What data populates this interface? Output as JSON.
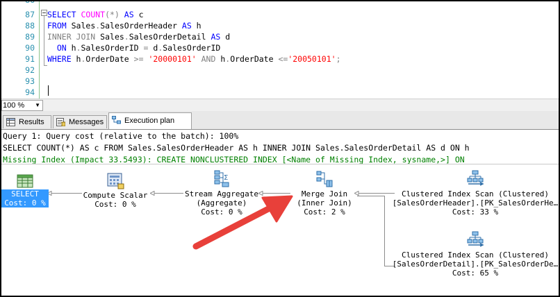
{
  "editor": {
    "lines": [
      {
        "num": "87",
        "tokens": [
          {
            "t": "SELECT ",
            "c": "kw"
          },
          {
            "t": "COUNT",
            "c": "fn"
          },
          {
            "t": "(*) ",
            "c": "op"
          },
          {
            "t": "AS ",
            "c": "kw"
          },
          {
            "t": "c",
            "c": ""
          }
        ]
      },
      {
        "num": "88",
        "tokens": [
          {
            "t": "FROM ",
            "c": "kw"
          },
          {
            "t": "Sales",
            "c": ""
          },
          {
            "t": ".",
            "c": "op"
          },
          {
            "t": "SalesOrderHeader ",
            "c": ""
          },
          {
            "t": "AS ",
            "c": "kw"
          },
          {
            "t": "h",
            "c": ""
          }
        ]
      },
      {
        "num": "89",
        "tokens": [
          {
            "t": "INNER JOIN ",
            "c": "op"
          },
          {
            "t": "Sales",
            "c": ""
          },
          {
            "t": ".",
            "c": "op"
          },
          {
            "t": "SalesOrderDetail ",
            "c": ""
          },
          {
            "t": "AS ",
            "c": "kw"
          },
          {
            "t": "d",
            "c": ""
          }
        ]
      },
      {
        "num": "90",
        "tokens": [
          {
            "t": "  ON ",
            "c": "kw"
          },
          {
            "t": "h",
            "c": ""
          },
          {
            "t": ".",
            "c": "op"
          },
          {
            "t": "SalesOrderID ",
            "c": ""
          },
          {
            "t": "= ",
            "c": "op"
          },
          {
            "t": "d",
            "c": ""
          },
          {
            "t": ".",
            "c": "op"
          },
          {
            "t": "SalesOrderID",
            "c": ""
          }
        ]
      },
      {
        "num": "91",
        "tokens": [
          {
            "t": "WHERE ",
            "c": "kw"
          },
          {
            "t": "h",
            "c": ""
          },
          {
            "t": ".",
            "c": "op"
          },
          {
            "t": "OrderDate ",
            "c": ""
          },
          {
            "t": ">= ",
            "c": "op"
          },
          {
            "t": "'20000101' ",
            "c": "str"
          },
          {
            "t": "AND ",
            "c": "op"
          },
          {
            "t": "h",
            "c": ""
          },
          {
            "t": ".",
            "c": "op"
          },
          {
            "t": "OrderDate ",
            "c": ""
          },
          {
            "t": "<=",
            "c": "op"
          },
          {
            "t": "'20050101'",
            "c": "str"
          },
          {
            "t": ";",
            "c": "op"
          }
        ]
      },
      {
        "num": "92",
        "tokens": []
      },
      {
        "num": "93",
        "tokens": []
      },
      {
        "num": "94",
        "tokens": []
      }
    ],
    "top_line_num": "86"
  },
  "zoom": {
    "value": "100 %"
  },
  "tabs": [
    {
      "label": "Results",
      "icon": "grid-icon"
    },
    {
      "label": "Messages",
      "icon": "messages-icon"
    },
    {
      "label": "Execution plan",
      "icon": "execution-plan-icon"
    }
  ],
  "messages": {
    "query_cost": "Query 1: Query cost (relative to the batch): 100%",
    "query_text": "SELECT COUNT(*) AS c FROM Sales.SalesOrderHeader AS h INNER JOIN Sales.SalesOrderDetail AS d ON h",
    "missing_index": "Missing Index (Impact 33.5493): CREATE NONCLUSTERED INDEX [<Name of Missing Index, sysname,>] ON"
  },
  "plan": {
    "select": {
      "label": "SELECT",
      "cost": "Cost: 0 %"
    },
    "compute_scalar": {
      "label": "Compute Scalar",
      "cost": "Cost: 0 %"
    },
    "stream_aggregate": {
      "label": "Stream Aggregate",
      "sub": "(Aggregate)",
      "cost": "Cost: 0 %"
    },
    "merge_join": {
      "label": "Merge Join",
      "sub": "(Inner Join)",
      "cost": "Cost: 2 %"
    },
    "scan1": {
      "label": "Clustered Index Scan (Clustered)",
      "object": "[SalesOrderHeader].[PK_SalesOrderHe…",
      "cost": "Cost: 33 %"
    },
    "scan2": {
      "label": "Clustered Index Scan (Clustered)",
      "object": "[SalesOrderDetail].[PK_SalesOrderDe…",
      "cost": "Cost: 65 %"
    }
  },
  "colors": {
    "annotation_arrow": "#e8403a",
    "selected_node": "#3399ff",
    "missing_index": "#008000"
  }
}
